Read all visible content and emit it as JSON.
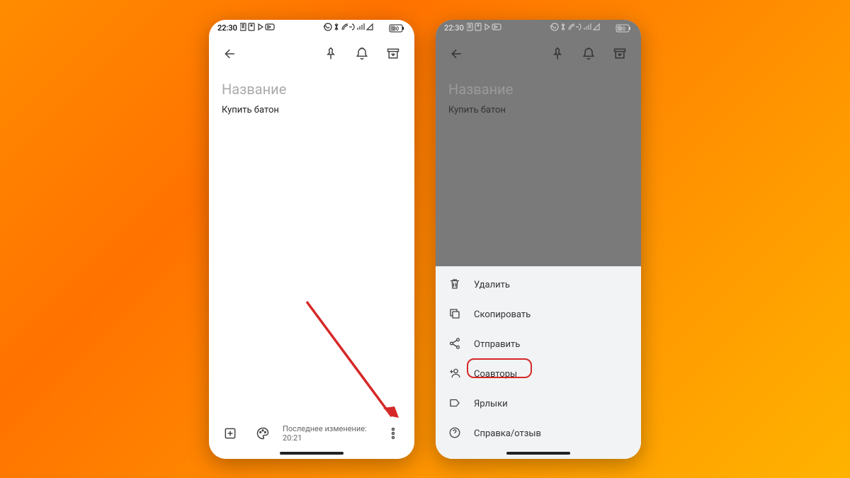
{
  "status": {
    "time": "22:30",
    "battery": "30"
  },
  "note": {
    "title_placeholder": "Название",
    "body": "Купить батон"
  },
  "bottom": {
    "last_edit": "Последнее изменение: 20:21"
  },
  "menu": {
    "items": [
      {
        "id": "delete",
        "label": "Удалить"
      },
      {
        "id": "copy",
        "label": "Скопировать"
      },
      {
        "id": "send",
        "label": "Отправить"
      },
      {
        "id": "collab",
        "label": "Соавторы"
      },
      {
        "id": "labels",
        "label": "Ярлыки"
      },
      {
        "id": "help",
        "label": "Справка/отзыв"
      }
    ]
  }
}
